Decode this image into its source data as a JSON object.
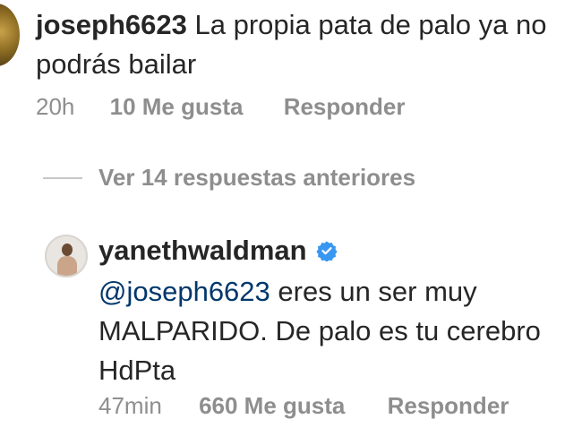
{
  "comment": {
    "username": "joseph6623",
    "text": "La propia pata de palo ya no podrás bailar",
    "time": "20h",
    "likes": "10 Me gusta",
    "reply_label": "Responder"
  },
  "view_replies": {
    "label": "Ver 14 respuestas anteriores"
  },
  "reply": {
    "username": "yanethwaldman",
    "verified_icon": "verified-badge-icon",
    "mention": "@joseph6623",
    "text": " eres un ser muy MALPARIDO. De palo es tu cerebro HdPta",
    "time": "47min",
    "likes": "660 Me gusta",
    "reply_label": "Responder"
  },
  "colors": {
    "text": "#262626",
    "secondary": "#8e8e8e",
    "mention": "#00376b",
    "verified": "#3897f0"
  }
}
